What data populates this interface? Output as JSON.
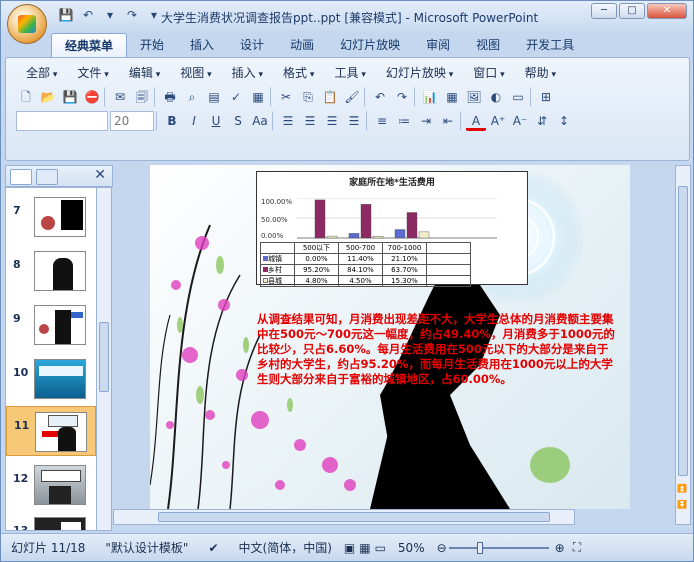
{
  "window": {
    "title": "大学生消费状况调查报告ppt..ppt [兼容模式] - Microsoft PowerPoint",
    "controls": [
      "─",
      "□",
      "✕"
    ]
  },
  "tabs": [
    {
      "label": "经典菜单",
      "active": true
    },
    {
      "label": "开始"
    },
    {
      "label": "插入"
    },
    {
      "label": "设计"
    },
    {
      "label": "动画"
    },
    {
      "label": "幻灯片放映"
    },
    {
      "label": "审阅"
    },
    {
      "label": "视图"
    },
    {
      "label": "开发工具"
    }
  ],
  "menus": [
    "全部",
    "文件",
    "编辑",
    "视图",
    "插入",
    "格式",
    "工具",
    "幻灯片放映",
    "窗口",
    "帮助"
  ],
  "toolbar": {
    "font_name": "",
    "font_size": "20"
  },
  "slides": [
    {
      "num": "7"
    },
    {
      "num": "8"
    },
    {
      "num": "9"
    },
    {
      "num": "10"
    },
    {
      "num": "11",
      "selected": true
    },
    {
      "num": "12"
    },
    {
      "num": "13"
    }
  ],
  "slide": {
    "chart": {
      "title": "家庭所在地*生活费用",
      "y_ticks": [
        "100.00%",
        "50.00%",
        "0.00%"
      ],
      "columns": [
        "500以下",
        "500-700",
        "700-1000",
        ""
      ],
      "rows": [
        {
          "label": "城镇",
          "values": [
            "0.00%",
            "11.40%",
            "21.10%",
            ""
          ]
        },
        {
          "label": "乡村",
          "values": [
            "95.20%",
            "84.10%",
            "63.70%",
            ""
          ]
        },
        {
          "label": "县城",
          "values": [
            "4.80%",
            "4.50%",
            "15.30%",
            ""
          ]
        }
      ]
    },
    "text": "从调查结果可知，月消费出现差距不大，大学生总体的月消费额主要集中在500元～700元这一幅度，约占49.40%，月消费多于1000元的比较少，只占6.60%。每月生活费用在500元以下的大部分是来自于乡村的大学生，约占95.20%，而每月生活费用在1000元以上的大学生则大部分来自于富裕的城镇地区，占60.00%。"
  },
  "status": {
    "slide_info": "幻灯片 11/18",
    "theme": "\"默认设计模板\"",
    "language": "中文(简体，中国)",
    "zoom": "50%"
  },
  "colors": {
    "accent_title": "#1e3a6a",
    "text_red": "#e30000",
    "series_town": "#5b6bd1",
    "series_village": "#8e2a63",
    "series_county": "#f2f0c8"
  },
  "chart_data": {
    "type": "bar",
    "title": "家庭所在地*生活费用",
    "categories": [
      "500以下",
      "500-700",
      "700-1000"
    ],
    "series": [
      {
        "name": "城镇",
        "values": [
          0.0,
          11.4,
          21.1
        ]
      },
      {
        "name": "乡村",
        "values": [
          95.2,
          84.1,
          63.7
        ]
      },
      {
        "name": "县城",
        "values": [
          4.8,
          4.5,
          15.3
        ]
      }
    ],
    "ylim": [
      0,
      100
    ]
  }
}
